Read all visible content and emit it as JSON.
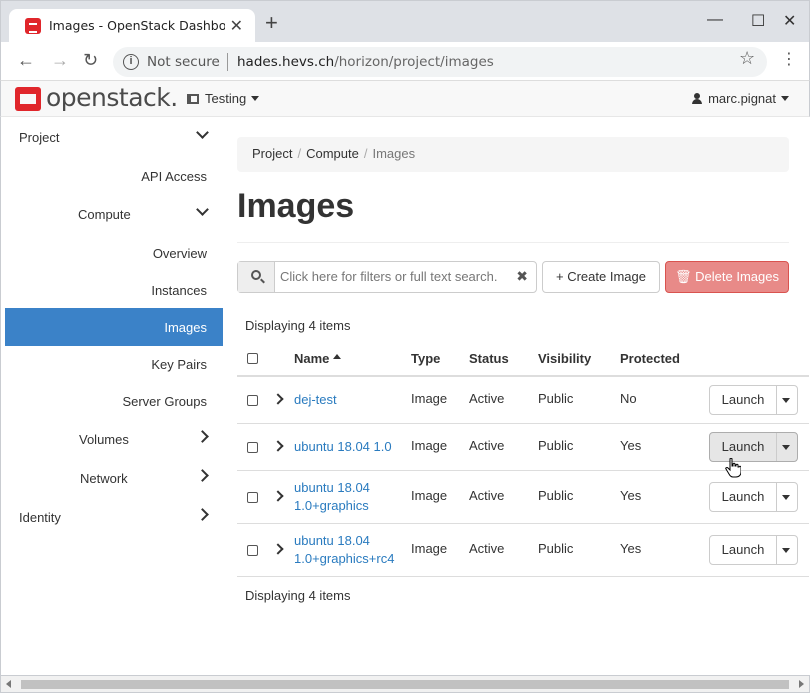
{
  "browser": {
    "tab_title": "Images - OpenStack Dashboard",
    "tab_close": "✕",
    "new_tab": "+",
    "back": "←",
    "forward": "→",
    "reload": "↻",
    "security_label": "Not secure",
    "url_host": "hades.hevs.ch",
    "url_path": "/horizon/project/images",
    "minimize": "—",
    "maximize": "☐",
    "close": "✕",
    "star": "☆",
    "menu": "⋮"
  },
  "header": {
    "logo_text": "openstack.",
    "project": "Testing",
    "user": "marc.pignat"
  },
  "sidebar": {
    "project": "Project",
    "api_access": "API Access",
    "compute": "Compute",
    "overview": "Overview",
    "instances": "Instances",
    "images": "Images",
    "key_pairs": "Key Pairs",
    "server_groups": "Server Groups",
    "volumes": "Volumes",
    "network": "Network",
    "identity": "Identity"
  },
  "breadcrumb": {
    "project": "Project",
    "compute": "Compute",
    "current": "Images",
    "sep": "/"
  },
  "page_title": "Images",
  "toolbar": {
    "search_placeholder": "Click here for filters or full text search.",
    "clear": "✖",
    "create_image": "+ Create Image",
    "delete_images": "🗑 Delete Images"
  },
  "table": {
    "count_text": "Displaying 4 items",
    "headers": {
      "name": "Name",
      "type": "Type",
      "status": "Status",
      "visibility": "Visibility",
      "protected": "Protected"
    },
    "rows": [
      {
        "name": "dej-test",
        "type": "Image",
        "status": "Active",
        "visibility": "Public",
        "protected": "No",
        "action": "Launch"
      },
      {
        "name": "ubuntu 18.04 1.0",
        "type": "Image",
        "status": "Active",
        "visibility": "Public",
        "protected": "Yes",
        "action": "Launch"
      },
      {
        "name": "ubuntu 18.04 1.0+graphics",
        "type": "Image",
        "status": "Active",
        "visibility": "Public",
        "protected": "Yes",
        "action": "Launch"
      },
      {
        "name": "ubuntu 18.04 1.0+graphics+rc4",
        "type": "Image",
        "status": "Active",
        "visibility": "Public",
        "protected": "Yes",
        "action": "Launch"
      }
    ]
  }
}
